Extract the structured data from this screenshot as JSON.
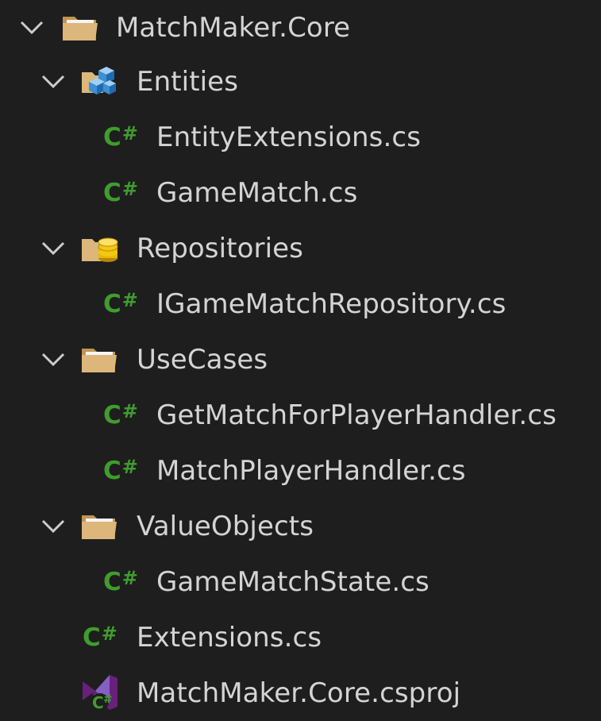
{
  "tree": {
    "rows": [
      {
        "label": "MatchMaker.Core",
        "icon": "folder-open-icon",
        "expanded": true
      },
      {
        "label": "Entities",
        "icon": "entities-cubes-folder-icon",
        "expanded": true
      },
      {
        "label": "EntityExtensions.cs",
        "icon": "csharp-file-icon"
      },
      {
        "label": "GameMatch.cs",
        "icon": "csharp-file-icon"
      },
      {
        "label": "Repositories",
        "icon": "repository-database-folder-icon",
        "expanded": true
      },
      {
        "label": "IGameMatchRepository.cs",
        "icon": "csharp-file-icon"
      },
      {
        "label": "UseCases",
        "icon": "folder-open-icon",
        "expanded": true
      },
      {
        "label": "GetMatchForPlayerHandler.cs",
        "icon": "csharp-file-icon"
      },
      {
        "label": "MatchPlayerHandler.cs",
        "icon": "csharp-file-icon"
      },
      {
        "label": "ValueObjects",
        "icon": "folder-open-icon",
        "expanded": true
      },
      {
        "label": "GameMatchState.cs",
        "icon": "csharp-file-icon"
      },
      {
        "label": "Extensions.cs",
        "icon": "csharp-file-icon"
      },
      {
        "label": "MatchMaker.Core.csproj",
        "icon": "csproj-file-icon"
      }
    ]
  },
  "colors": {
    "background": "#1e1e1e",
    "text": "#d4d4d4",
    "chevron": "#cccccc",
    "csharp_green": "#3f9d2d",
    "folder_tan": "#dcb67a",
    "vs_purple": "#68217a"
  }
}
